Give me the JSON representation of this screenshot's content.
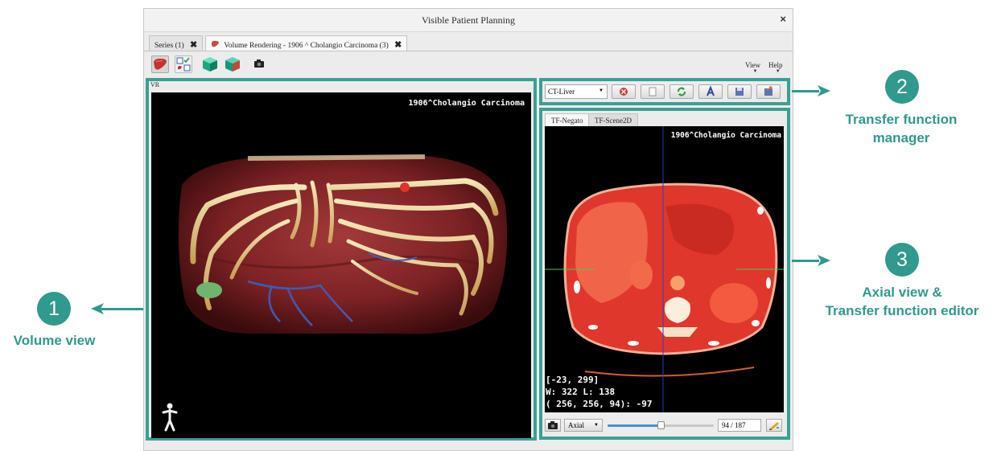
{
  "window": {
    "title": "Visible Patient Planning",
    "close_glyph": "×"
  },
  "tabs": [
    {
      "label": "Series (1)",
      "close": "✖"
    },
    {
      "label": "Volume Rendering - 1906 ^ Cholangio Carcinoma (3)",
      "close": "✖"
    }
  ],
  "menu": {
    "view": "View",
    "help": "Help"
  },
  "toolbar_icons": [
    "liver-icon",
    "model-select-icon",
    "cube-green-icon",
    "cube-teal-icon",
    "camera-icon"
  ],
  "volume_view": {
    "label": "VR",
    "patient_text": "1906^Cholangio Carcinoma",
    "orientation_icon": "human-figure-icon"
  },
  "tf_manager": {
    "preset_value": "CT-Liver",
    "buttons": [
      "delete-icon",
      "blank-icon",
      "refresh-icon",
      "rename-icon",
      "save-icon",
      "export-icon"
    ]
  },
  "axial_view": {
    "tabs": [
      "TF-Negato",
      "TF-Scene2D"
    ],
    "patient_text": "1906^Cholangio Carcinoma",
    "info_lines": [
      "[-23, 299]",
      "W: 322 L: 138",
      "( 256, 256,  94): -97"
    ],
    "orientation_value": "Axial",
    "slice_value": "94 / 187",
    "slice_fraction": 0.5
  },
  "annotations": [
    {
      "number": "1",
      "label_lines": [
        "Volume view"
      ]
    },
    {
      "number": "2",
      "label_lines": [
        "Transfer function",
        "manager"
      ]
    },
    {
      "number": "3",
      "label_lines": [
        "Axial view &",
        "Transfer function editor"
      ]
    }
  ],
  "colors": {
    "accent": "#3aa093",
    "annotation": "#2f9a8d"
  }
}
